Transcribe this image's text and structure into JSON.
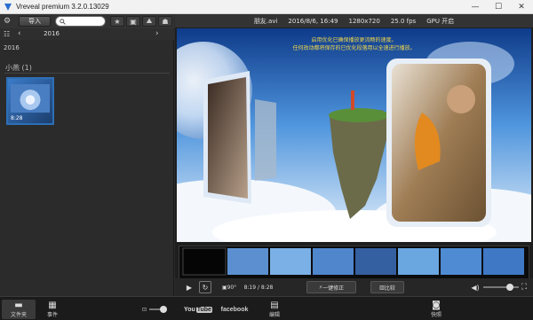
{
  "window": {
    "title": "Vreveal premium 3.2.0.13029",
    "controls": [
      "minimize",
      "maximize",
      "close"
    ]
  },
  "library": {
    "import_label": "导入",
    "search_placeholder": "",
    "year_nav": "2016",
    "year_side": "2016",
    "group_label": "小燕 (1)",
    "items": [
      {
        "duration": "8:28"
      }
    ]
  },
  "video_info": {
    "filename": "朋友.avi",
    "datetime": "2016/8/6, 16:49",
    "resolution": "1280x720",
    "fps": "25.0 fps",
    "gpu": "GPU 开启"
  },
  "preview": {
    "caption_line1": "启用优化已确保播放更流畅的速度。",
    "caption_line2": "任何改动都将保存的已优化段落用以全速进行播放。"
  },
  "player": {
    "rotate_label": "90°",
    "time": "8:19 / 8:28",
    "fix_label": "一键修正",
    "compare_label": "比较",
    "volume": 0.85
  },
  "bottom": {
    "folder_label": "文件夹",
    "event_label": "事件",
    "youtube_you": "You",
    "youtube_tube": "Tube",
    "facebook_label": "facebook",
    "edit_label": "编辑",
    "snapshot_label": "快照"
  },
  "colors": {
    "selection_border": "#2d6fb6",
    "caption": "#f2d84a",
    "accent_blue": "#3a7bc8"
  }
}
